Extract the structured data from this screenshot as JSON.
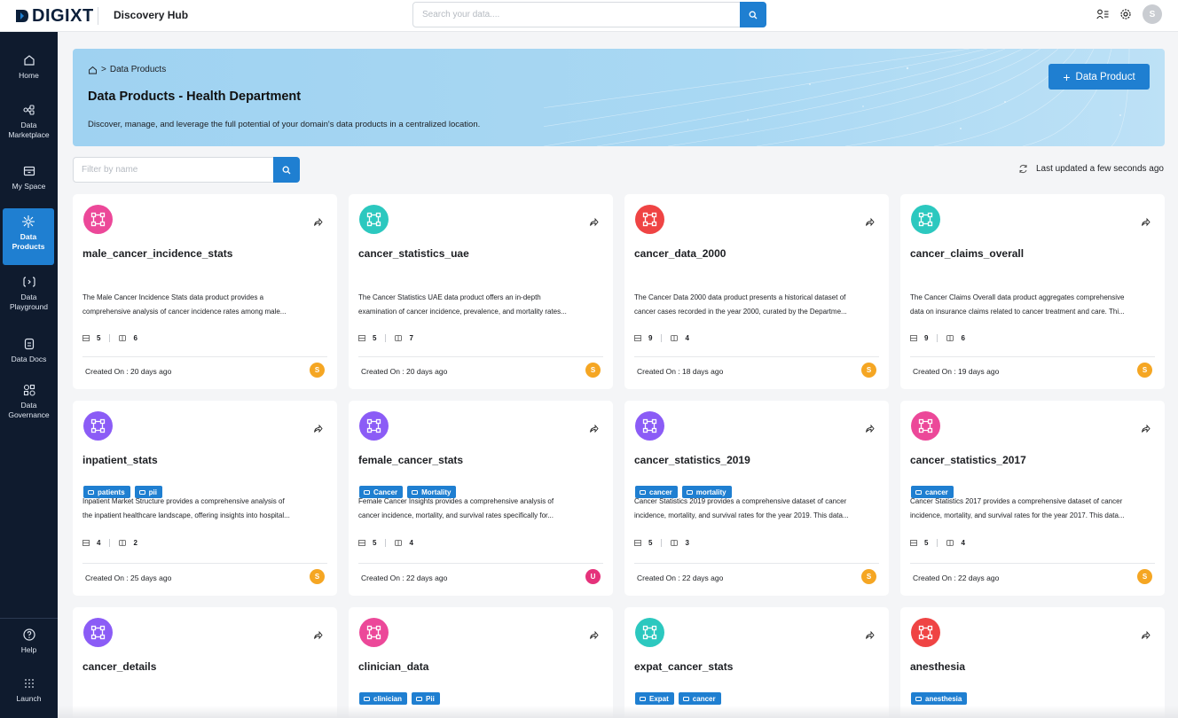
{
  "brand": {
    "logo": "DIGIXT",
    "app_name": "Discovery Hub"
  },
  "search": {
    "placeholder": "Search your data...."
  },
  "user": {
    "initial": "S"
  },
  "sidebar": {
    "items": [
      {
        "label": "Home",
        "icon": "home-icon"
      },
      {
        "label": "Data Marketplace",
        "icon": "marketplace-icon"
      },
      {
        "label": "My Space",
        "icon": "inbox-icon"
      },
      {
        "label": "Data Products",
        "icon": "data-products-icon",
        "active": true
      },
      {
        "label": "Data Playground",
        "icon": "playground-icon"
      },
      {
        "label": "Data Docs",
        "icon": "docs-icon"
      },
      {
        "label": "Data Governance",
        "icon": "governance-icon"
      }
    ],
    "bottom": [
      {
        "label": "Help",
        "icon": "help-icon"
      },
      {
        "label": "Launch",
        "icon": "grid-icon"
      }
    ]
  },
  "hero": {
    "breadcrumb": "Data Products",
    "title": "Data Products - Health Department",
    "subtitle": "Discover, manage, and leverage the full potential of your domain's data products in a centralized location.",
    "add_button": "Data Product"
  },
  "filter": {
    "placeholder": "Filter by name"
  },
  "last_updated": "Last updated a few seconds ago",
  "colors": {
    "accent": "#1f7fd1",
    "sidebar": "#0f1b2e",
    "orange": "#f5a623",
    "magenta": "#e5327b"
  },
  "cards": [
    {
      "name": "male_cancer_incidence_stats",
      "icon_color": "#ec4899",
      "tags": [],
      "desc1": "The Male Cancer Incidence Stats data product provides a",
      "desc2": "comprehensive analysis of cancer incidence rates among male...",
      "tables": "5",
      "columns": "6",
      "created": "Created On : 20 days ago",
      "owner": "S",
      "owner_color": "#f5a623"
    },
    {
      "name": "cancer_statistics_uae",
      "icon_color": "#2cc8bf",
      "tags": [],
      "desc1": "The Cancer Statistics UAE data product offers an in-depth",
      "desc2": "examination of cancer incidence, prevalence, and mortality rates...",
      "tables": "5",
      "columns": "7",
      "created": "Created On : 20 days ago",
      "owner": "S",
      "owner_color": "#f5a623"
    },
    {
      "name": "cancer_data_2000",
      "icon_color": "#ef4444",
      "tags": [],
      "desc1": "The Cancer Data 2000 data product presents a historical dataset of",
      "desc2": "cancer cases recorded in the year 2000, curated by the Departme...",
      "tables": "9",
      "columns": "4",
      "created": "Created On : 18 days ago",
      "owner": "S",
      "owner_color": "#f5a623"
    },
    {
      "name": "cancer_claims_overall",
      "icon_color": "#2cc8bf",
      "tags": [],
      "desc1": "The Cancer Claims Overall data product aggregates comprehensive",
      "desc2": "data on insurance claims related to cancer treatment and care. Thi...",
      "tables": "9",
      "columns": "6",
      "created": "Created On : 19 days ago",
      "owner": "S",
      "owner_color": "#f5a623"
    },
    {
      "name": "inpatient_stats",
      "icon_color": "#8b5cf6",
      "tags": [
        "patients",
        "pii"
      ],
      "desc1": "Inpatient Market Structure provides a comprehensive analysis of",
      "desc2": "the inpatient healthcare landscape, offering insights into hospital...",
      "tables": "4",
      "columns": "2",
      "created": "Created On : 25 days ago",
      "owner": "S",
      "owner_color": "#f5a623"
    },
    {
      "name": "female_cancer_stats",
      "icon_color": "#8b5cf6",
      "tags": [
        "Cancer",
        "Mortality"
      ],
      "desc1": "Female Cancer Insights provides a comprehensive analysis of",
      "desc2": "cancer incidence, mortality, and survival rates specifically for...",
      "tables": "5",
      "columns": "4",
      "created": "Created On : 22 days ago",
      "owner": "U",
      "owner_color": "#e5327b"
    },
    {
      "name": "cancer_statistics_2019",
      "icon_color": "#8b5cf6",
      "tags": [
        "cancer",
        "mortality"
      ],
      "desc1": "Cancer Statistics 2019 provides a comprehensive dataset of cancer",
      "desc2": "incidence, mortality, and survival rates for the year 2019. This data...",
      "tables": "5",
      "columns": "3",
      "created": "Created On : 22 days ago",
      "owner": "S",
      "owner_color": "#f5a623"
    },
    {
      "name": "cancer_statistics_2017",
      "icon_color": "#ec4899",
      "tags": [
        "cancer"
      ],
      "desc1": "Cancer Statistics 2017 provides a comprehensive dataset of cancer",
      "desc2": "incidence, mortality, and survival rates for the year 2017. This data...",
      "tables": "5",
      "columns": "4",
      "created": "Created On : 22 days ago",
      "owner": "S",
      "owner_color": "#f5a623"
    },
    {
      "name": "cancer_details",
      "icon_color": "#8b5cf6",
      "tags": []
    },
    {
      "name": "clinician_data",
      "icon_color": "#ec4899",
      "tags": [
        "clinician",
        "Pii"
      ]
    },
    {
      "name": "expat_cancer_stats",
      "icon_color": "#2cc8bf",
      "tags": [
        "Expat",
        "cancer"
      ]
    },
    {
      "name": "anesthesia",
      "icon_color": "#ef4444",
      "tags": [
        "anesthesia"
      ]
    }
  ]
}
